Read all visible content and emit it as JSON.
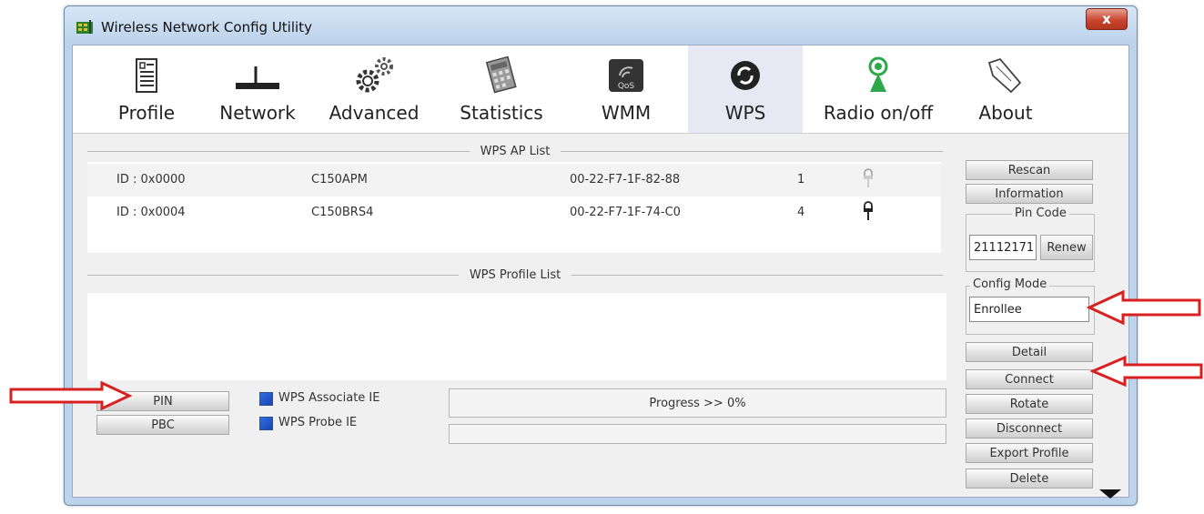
{
  "window": {
    "title": "Wireless Network Config Utility",
    "close_label": "x"
  },
  "tabs": [
    {
      "label": "Profile",
      "icon": "profile-icon"
    },
    {
      "label": "Network",
      "icon": "network-icon"
    },
    {
      "label": "Advanced",
      "icon": "advanced-gears-icon"
    },
    {
      "label": "Statistics",
      "icon": "statistics-icon"
    },
    {
      "label": "WMM",
      "icon": "wmm-qos-icon"
    },
    {
      "label": "WPS",
      "icon": "wps-icon",
      "active": true
    },
    {
      "label": "Radio on/off",
      "icon": "radio-icon"
    },
    {
      "label": "About",
      "icon": "about-icon"
    }
  ],
  "ap_list": {
    "title": "WPS AP List",
    "rows": [
      {
        "id": "ID : 0x0000",
        "ssid": "C150APM",
        "bssid": "00-22-F7-1F-82-88",
        "channel": "1",
        "lock": "unlocked"
      },
      {
        "id": "ID : 0x0004",
        "ssid": "C150BRS4",
        "bssid": "00-22-F7-1F-74-C0",
        "channel": "4",
        "lock": "locked"
      }
    ]
  },
  "profile_list": {
    "title": "WPS Profile List"
  },
  "bottom": {
    "pin_label": "PIN",
    "pbc_label": "PBC",
    "associate_ie_label": "WPS Associate IE",
    "probe_ie_label": "WPS Probe IE",
    "progress_text": "Progress >> 0%",
    "progress_value": 0
  },
  "right": {
    "rescan_label": "Rescan",
    "information_label": "Information",
    "pin_code_group": "Pin Code",
    "pin_code_value": "21112171",
    "renew_label": "Renew",
    "config_mode_group": "Config Mode",
    "config_mode_value": "Enrollee",
    "detail_label": "Detail",
    "connect_label": "Connect",
    "rotate_label": "Rotate",
    "disconnect_label": "Disconnect",
    "export_profile_label": "Export Profile",
    "delete_label": "Delete"
  },
  "colors": {
    "accent_arrow": "#d92020",
    "checkbox": "#1f4fc4"
  }
}
